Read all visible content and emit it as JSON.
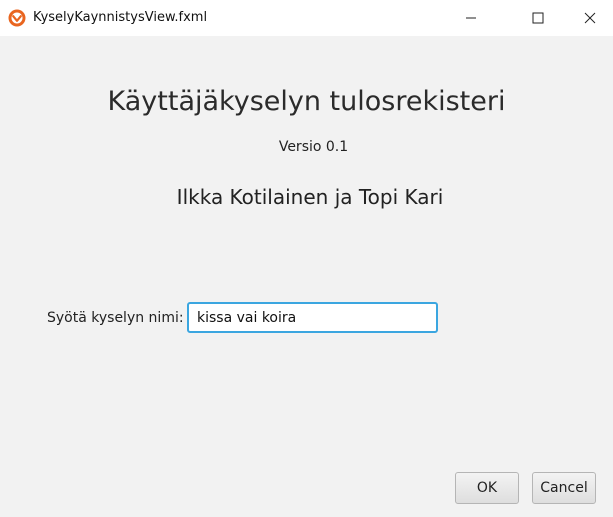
{
  "window": {
    "title": "KyselyKaynnistysView.fxml",
    "icon": "app-logo-icon",
    "controls": [
      "minimize-icon",
      "maximize-icon",
      "close-icon"
    ]
  },
  "main": {
    "title": "Käyttäjäkyselyn tulosrekisteri",
    "version": "Versio 0.1",
    "authors": "Ilkka Kotilainen ja Topi Kari"
  },
  "form": {
    "name_label": "Syötä kyselyn nimi:",
    "name_value": "kissa vai koira"
  },
  "buttons": {
    "ok": "OK",
    "cancel": "Cancel"
  },
  "colors": {
    "background": "#f2f2f2",
    "focus_border": "#3ba6e0",
    "titlebar": "#ffffff"
  }
}
